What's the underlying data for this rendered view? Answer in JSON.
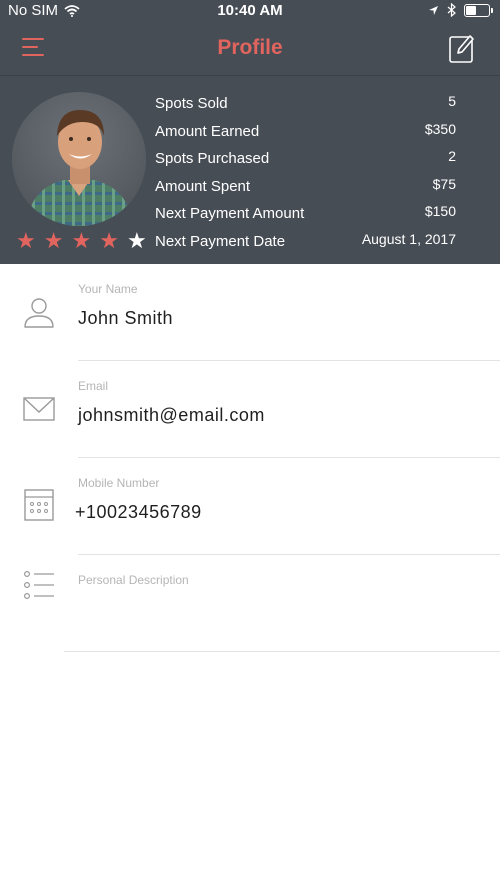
{
  "status_bar": {
    "carrier": "No SIM",
    "time": "10:40 AM"
  },
  "nav": {
    "title": "Profile"
  },
  "profile": {
    "rating": 4,
    "rating_max": 5,
    "stats": [
      {
        "label": "Spots Sold",
        "value": "5"
      },
      {
        "label": "Amount Earned",
        "value": "$350"
      },
      {
        "label": "Spots Purchased",
        "value": "2"
      },
      {
        "label": "Amount Spent",
        "value": "$75"
      },
      {
        "label": "Next Payment Amount",
        "value": "$150"
      },
      {
        "label": "Next Payment Date",
        "value": "August 1, 2017"
      }
    ]
  },
  "form": {
    "name": {
      "label": "Your Name",
      "value": "John Smith"
    },
    "email": {
      "label": "Email",
      "value": "johnsmith@email.com"
    },
    "mobile": {
      "label": "Mobile Number",
      "value": "+10023456789"
    },
    "description": {
      "label": "Personal Description",
      "value": ""
    }
  },
  "colors": {
    "header_bg": "#474d55",
    "accent": "#e2645e",
    "placeholder": "#b5b5b5",
    "divider": "#e3e3e3"
  },
  "icons": [
    "wifi-icon",
    "location-arrow-icon",
    "bluetooth-icon",
    "battery-icon",
    "menu-icon",
    "edit-icon",
    "star-icon",
    "user-icon",
    "envelope-icon",
    "keypad-icon",
    "list-icon"
  ]
}
